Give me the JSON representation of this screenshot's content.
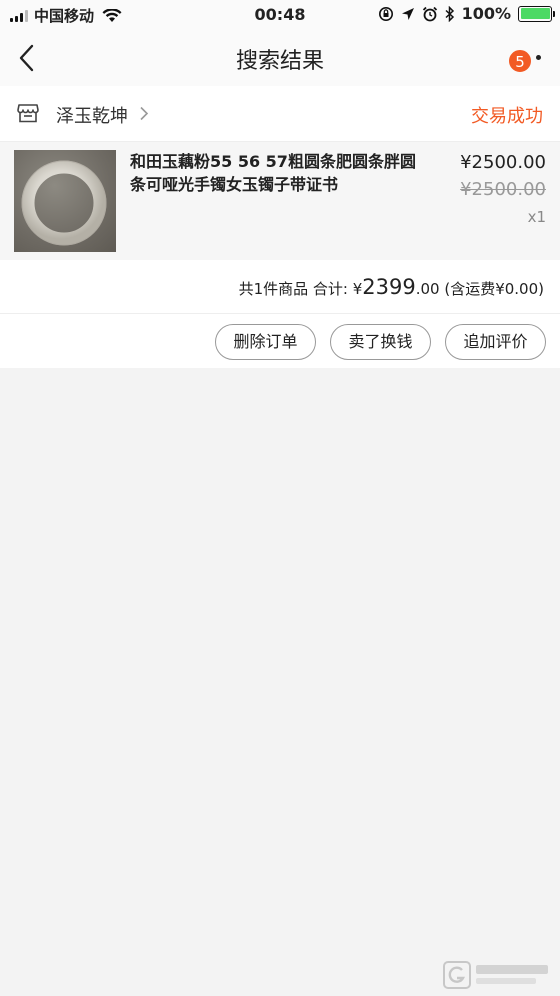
{
  "status_bar": {
    "carrier": "中国移动",
    "time": "00:48",
    "battery_percent": "100%",
    "battery_color": "#4cd964"
  },
  "nav": {
    "title": "搜索结果",
    "badge_count": "5",
    "badge_color": "#f25a24",
    "back_icon": "chevron-left-icon",
    "more_icon": "ellipsis-icon"
  },
  "shop": {
    "name": "泽玉乾坤",
    "status": "交易成功",
    "status_color": "#f25a24",
    "icon": "store-icon"
  },
  "product": {
    "title": "和田玉藕粉55 56 57粗圆条肥圆条胖圆条可哑光手镯女玉镯子带证书",
    "price": "¥2500.00",
    "original_price": "¥2500.00",
    "quantity": "x1"
  },
  "totals": {
    "summary": "共1件商品 合计: ¥",
    "amount_int": "2399",
    "amount_dec": ".00",
    "shipping": " (含运费¥0.00)"
  },
  "actions": {
    "delete_label": "删除订单",
    "resell_label": "卖了换钱",
    "review_label": "追加评价"
  }
}
